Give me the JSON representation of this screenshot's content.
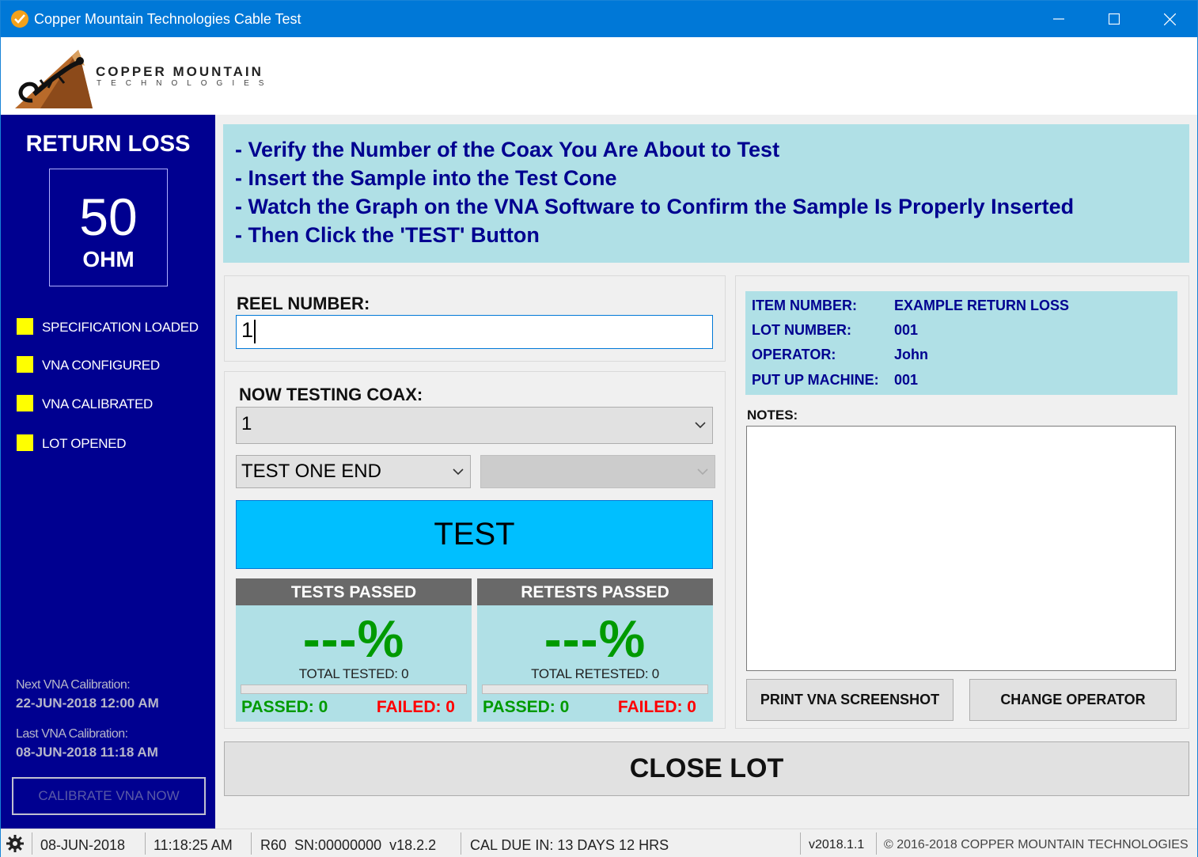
{
  "window": {
    "title": "Copper Mountain Technologies Cable Test"
  },
  "logo": {
    "name": "COPPER MOUNTAIN",
    "sub": "TECHNOLOGIES"
  },
  "left_panel": {
    "title": "RETURN LOSS",
    "impedance_value": "50",
    "impedance_unit": "OHM",
    "status_items": [
      {
        "label": "SPECIFICATION LOADED",
        "color": "#ffff00"
      },
      {
        "label": "VNA CONFIGURED",
        "color": "#ffff00"
      },
      {
        "label": "VNA CALIBRATED",
        "color": "#ffff00"
      },
      {
        "label": "LOT OPENED",
        "color": "#ffff00"
      }
    ],
    "next_cal_label": "Next VNA Calibration:",
    "next_cal_value": "22-JUN-2018 12:00 AM",
    "last_cal_label": "Last VNA Calibration:",
    "last_cal_value": "08-JUN-2018 11:18 AM",
    "calibrate_button": "CALIBRATE VNA NOW"
  },
  "instructions": [
    "- Verify the Number of the Coax You Are About to Test",
    "- Insert the Sample into the Test Cone",
    "- Watch the Graph on the VNA Software to Confirm the Sample Is Properly Inserted",
    "- Then Click the 'TEST' Button"
  ],
  "reel": {
    "label": "REEL NUMBER:",
    "value": "1"
  },
  "testing": {
    "label": "NOW TESTING COAX:",
    "coax_selected": "1",
    "mode_selected": "TEST ONE END",
    "secondary_selected": "",
    "test_button": "TEST"
  },
  "tests_passed": {
    "title": "TESTS PASSED",
    "percent": "---%",
    "total": "TOTAL TESTED: 0",
    "progress": 0,
    "passed": "PASSED: 0",
    "failed": "FAILED: 0"
  },
  "retests_passed": {
    "title": "RETESTS PASSED",
    "percent": "---%",
    "total": "TOTAL RETESTED: 0",
    "progress": 0,
    "passed": "PASSED: 0",
    "failed": "FAILED: 0"
  },
  "info": {
    "rows": [
      {
        "key": "ITEM NUMBER:",
        "value": "EXAMPLE RETURN LOSS"
      },
      {
        "key": "LOT NUMBER:",
        "value": "001"
      },
      {
        "key": "OPERATOR:",
        "value": "John"
      },
      {
        "key": "PUT UP MACHINE:",
        "value": "001"
      }
    ],
    "notes_label": "NOTES:",
    "notes_value": "",
    "print_button": "PRINT VNA SCREENSHOT",
    "operator_button": "CHANGE OPERATOR"
  },
  "close_lot_button": "CLOSE LOT",
  "statusbar": {
    "date": "08-JUN-2018",
    "time": "11:18:25 AM",
    "device": "R60  SN:00000000  v18.2.2",
    "cal_due": "CAL DUE IN: 13 DAYS 12 HRS",
    "version": "v2018.1.1",
    "copyright": "© 2016-2018 COPPER MOUNTAIN TECHNOLOGIES"
  }
}
